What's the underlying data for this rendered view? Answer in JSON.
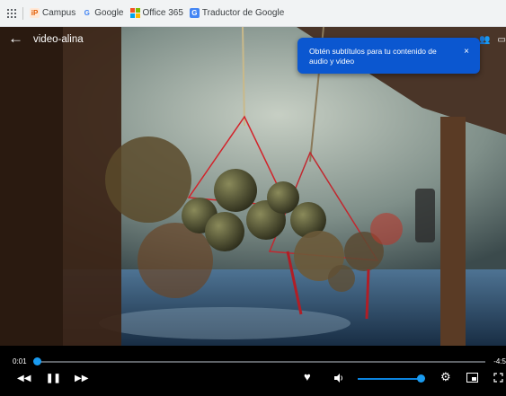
{
  "bookmarks": [
    {
      "label": "Campus",
      "icon": "campus-icon"
    },
    {
      "label": "Google",
      "icon": "google-icon"
    },
    {
      "label": "Office 365",
      "icon": "office-icon"
    },
    {
      "label": "Traductor de Google",
      "icon": "translate-icon"
    }
  ],
  "header": {
    "title": "video-alina"
  },
  "toast": {
    "text": "Obtén subtítulos para tu contenido de audio y video",
    "close": "×"
  },
  "player": {
    "current_time": "0:01",
    "remaining_time": "-4:5",
    "progress": 0.005,
    "volume": 1.0
  },
  "colors": {
    "accent": "#0b84e0",
    "toast_bg": "#0b57d0",
    "bookmarks_bg": "#f1f3f4"
  }
}
